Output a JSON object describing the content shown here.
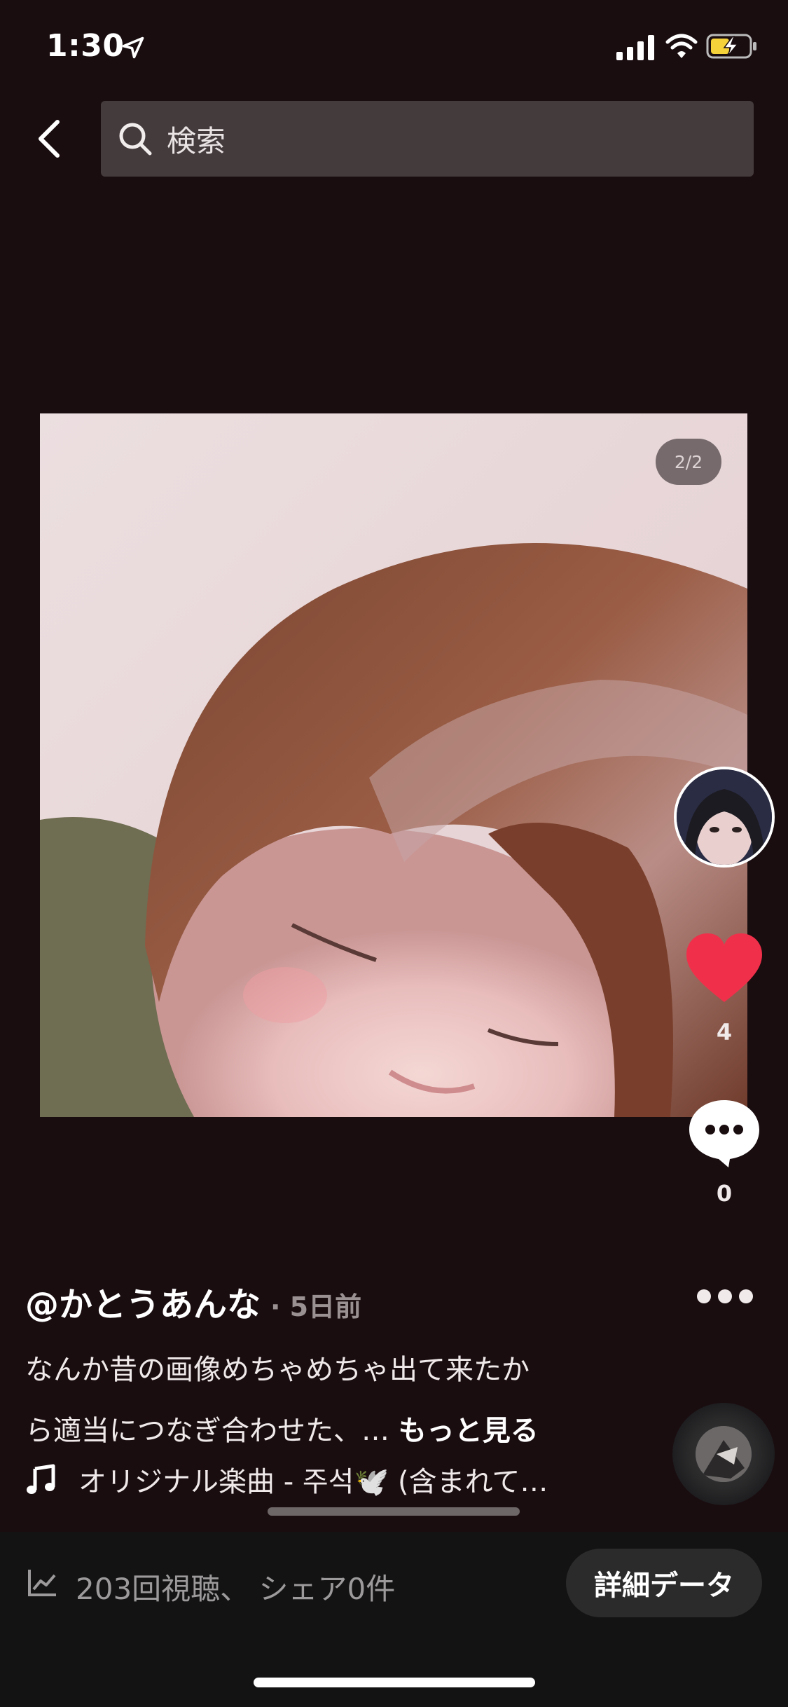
{
  "status_bar": {
    "time": "1:30"
  },
  "header": {
    "search_placeholder": "検索"
  },
  "photo": {
    "page_counter": "2/2"
  },
  "actions": {
    "like_count": "4",
    "comment_count": "0"
  },
  "post": {
    "author": "@かとうあんな",
    "time_ago": "· 5日前",
    "caption_line1": "なんか昔の画像めちゃめちゃ出て来たか",
    "caption_line2": "ら適当につなぎ合わせた、…",
    "more_label": "もっと見る",
    "music": "オリジナル楽曲 - 주석🕊️ (含まれて…"
  },
  "stats": {
    "text": "203回視聴、 シェア0件",
    "detail_button": "詳細データ"
  },
  "colors": {
    "like": "#f0304a",
    "background": "#1a0d10",
    "stats_bar": "#131313"
  }
}
